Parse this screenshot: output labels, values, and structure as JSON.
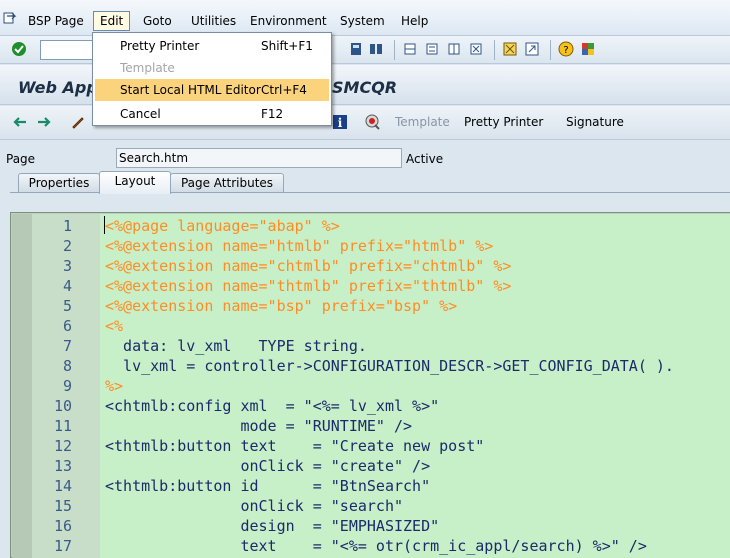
{
  "menubar": {
    "items": [
      {
        "label": "BSP Page"
      },
      {
        "label": "Edit"
      },
      {
        "label": "Goto"
      },
      {
        "label": "Utilities"
      },
      {
        "label": "Environment"
      },
      {
        "label": "System"
      },
      {
        "label": "Help"
      }
    ]
  },
  "edit_menu": {
    "items": [
      {
        "label": "Pretty Printer",
        "shortcut": "Shift+F1"
      },
      {
        "label": "Template",
        "shortcut": ""
      },
      {
        "label": "Start Local HTML Editor",
        "shortcut": "Ctrl+F4"
      },
      {
        "label": "Cancel",
        "shortcut": "F12"
      }
    ]
  },
  "title": {
    "left": "Web App",
    "right": "SMCQR"
  },
  "app_toolbar": {
    "template_label": "Template",
    "pretty_printer_label": "Pretty Printer",
    "signature_label": "Signature"
  },
  "page_field": {
    "label": "Page",
    "value": "Search.htm",
    "status": "Active"
  },
  "tabs": [
    {
      "label": "Properties"
    },
    {
      "label": "Layout"
    },
    {
      "label": "Page Attributes"
    }
  ],
  "editor": {
    "line_numbers": [
      "1",
      "2",
      "3",
      "4",
      "5",
      "6",
      "7",
      "8",
      "9",
      "10",
      "11",
      "12",
      "13",
      "14",
      "15",
      "16",
      "17"
    ],
    "lines": [
      "<%@page language=\"abap\" %>",
      "<%@extension name=\"htmlb\" prefix=\"htmlb\" %>",
      "<%@extension name=\"chtmlb\" prefix=\"chtmlb\" %>",
      "<%@extension name=\"thtmlb\" prefix=\"thtmlb\" %>",
      "<%@extension name=\"bsp\" prefix=\"bsp\" %>",
      "<%",
      "  data: lv_xml   TYPE string.",
      "  lv_xml = controller->CONFIGURATION_DESCR->GET_CONFIG_DATA( ).",
      "%>",
      "<chtmlb:config xml  = \"<%= lv_xml %>\"",
      "               mode = \"RUNTIME\" />",
      "<thtmlb:button text    = \"Create new post\"",
      "               onClick = \"create\" />",
      "<thtmlb:button id      = \"BtnSearch\"",
      "               onClick = \"search\"",
      "               design  = \"EMPHASIZED\"",
      "               text    = \"<%= otr(crm_ic_appl/search) %>\" />"
    ]
  },
  "colors": {
    "editor_background": "#c8f0c8",
    "directive": "#ff8c24",
    "keyword": "#2030d0",
    "menu_highlight": "#fbd37d"
  },
  "icons": [
    "enter-check-icon",
    "back-icon",
    "forward-icon",
    "print-icon",
    "find-icon",
    "find-next-icon",
    "first-page-icon",
    "previous-page-icon",
    "next-page-icon",
    "last-page-icon",
    "create-session-icon",
    "shortcut-icon",
    "help-icon",
    "customize-layout-icon",
    "edit-pencil-icon",
    "info-icon",
    "signature-stamp-icon"
  ]
}
